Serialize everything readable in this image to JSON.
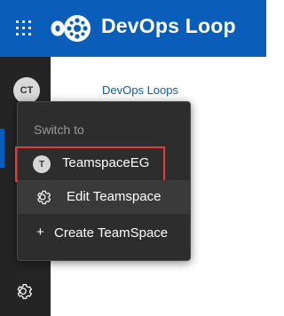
{
  "header": {
    "app_title": "DevOps Loop",
    "icons": {
      "menu": "app-grid-icon",
      "logo": "devops-loop-logo"
    },
    "colors": {
      "brand": "#0a5db8"
    }
  },
  "sidebar": {
    "user_avatar_initials": "CT",
    "settings_icon": "gear-icon"
  },
  "main": {
    "link_text": "DevOps Loops"
  },
  "flyout": {
    "heading": "Switch to",
    "teamspace": {
      "avatar_initial": "T",
      "label": "TeamspaceEG"
    },
    "edit": {
      "icon": "gear-icon",
      "label": "Edit Teamspace"
    },
    "create": {
      "icon": "+",
      "label": "Create TeamSpace"
    },
    "colors": {
      "highlight_border": "#e8393a"
    }
  }
}
